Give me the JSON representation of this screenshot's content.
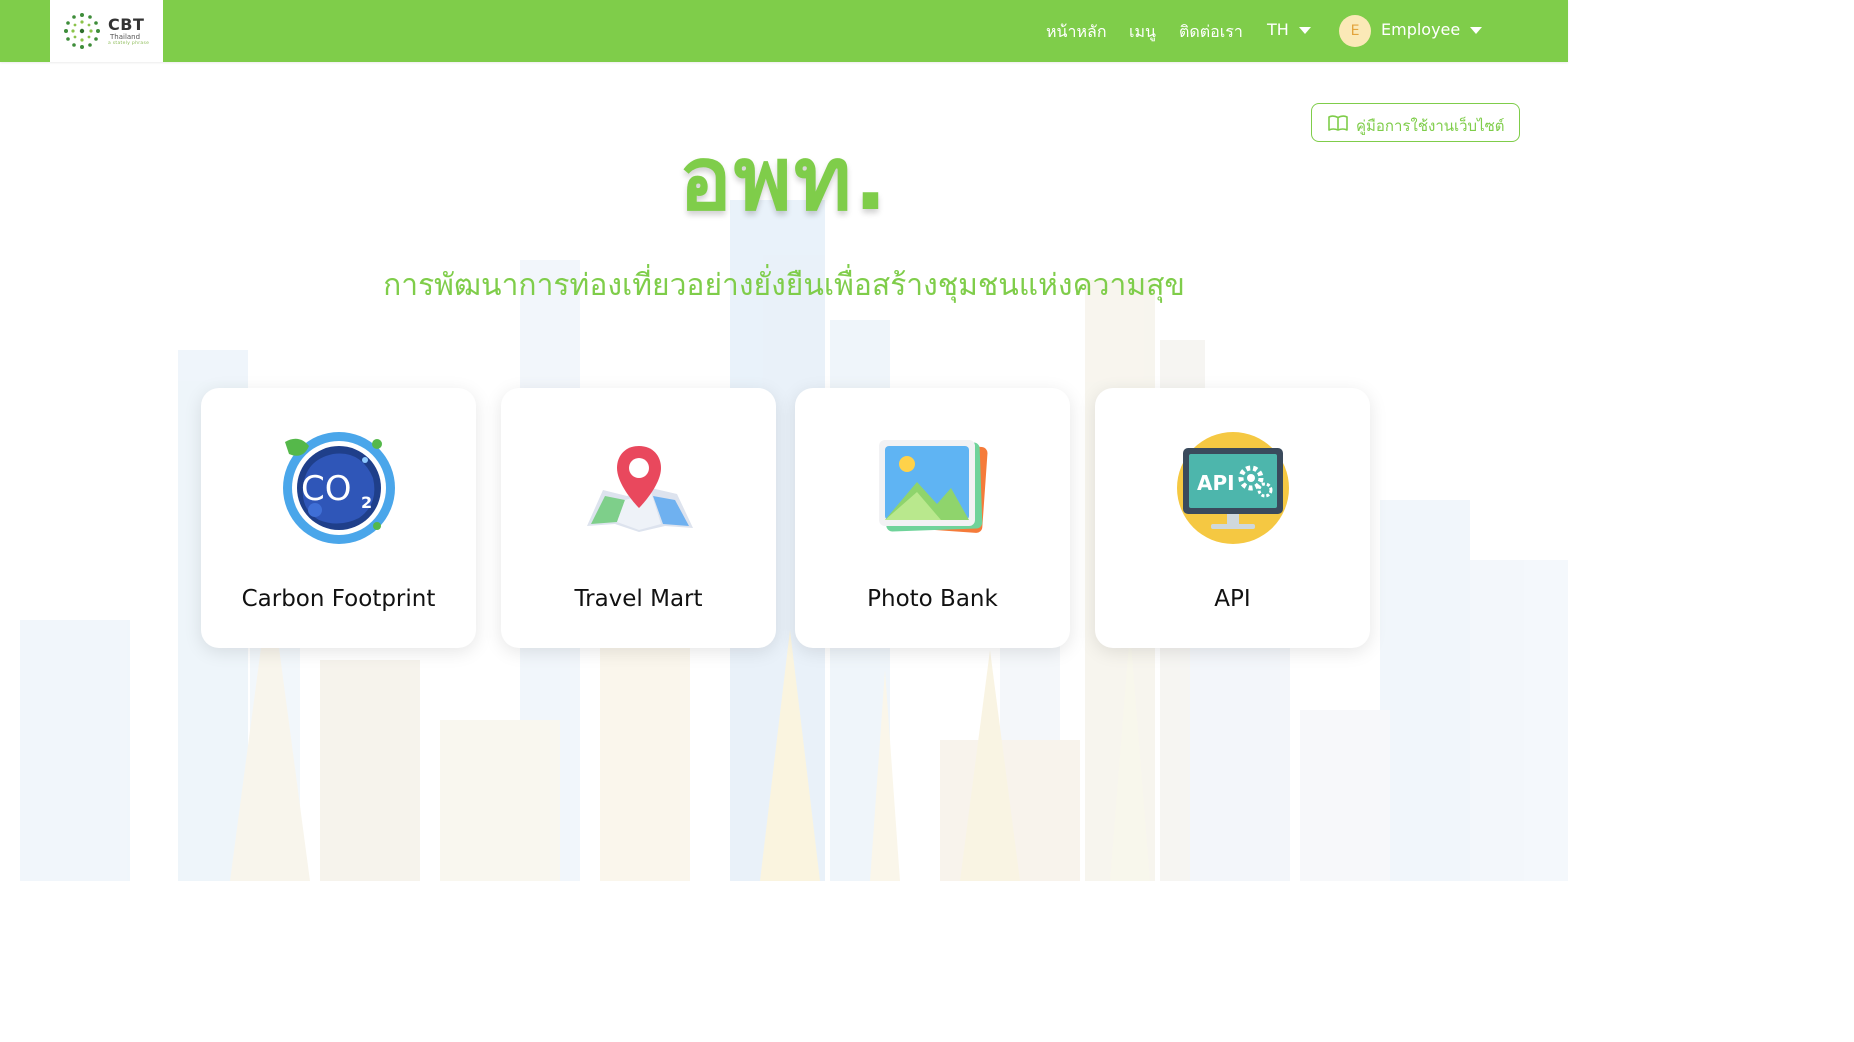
{
  "header": {
    "logo": {
      "title": "CBT",
      "subtitle": "Thailand",
      "tagline": "a stately phrase"
    },
    "nav": {
      "home": "หน้าหลัก",
      "menu": "เมนู",
      "contact": "ติดต่อเรา",
      "language": "TH"
    },
    "user": {
      "initial": "E",
      "name": "Employee"
    }
  },
  "manual_button": {
    "label": "คู่มือการใช้งานเว็บไซต์"
  },
  "hero": {
    "title": "อพท.",
    "subtitle": "การพัฒนาการท่องเที่ยวอย่างยั่งยืนเพื่อสร้างชุมชนแห่งความสุข"
  },
  "cards": [
    {
      "label": "Carbon Footprint",
      "icon": "co2-icon"
    },
    {
      "label": "Travel Mart",
      "icon": "map-pin-icon"
    },
    {
      "label": "Photo Bank",
      "icon": "photo-icon"
    },
    {
      "label": "API",
      "icon": "api-monitor-icon"
    }
  ],
  "icon_text": {
    "co2": "CO",
    "co2_sub": "2",
    "api": "API"
  },
  "colors": {
    "brand_green": "#7fcd4a",
    "avatar_bg": "#fbe9b7",
    "avatar_text": "#e3a43c"
  }
}
